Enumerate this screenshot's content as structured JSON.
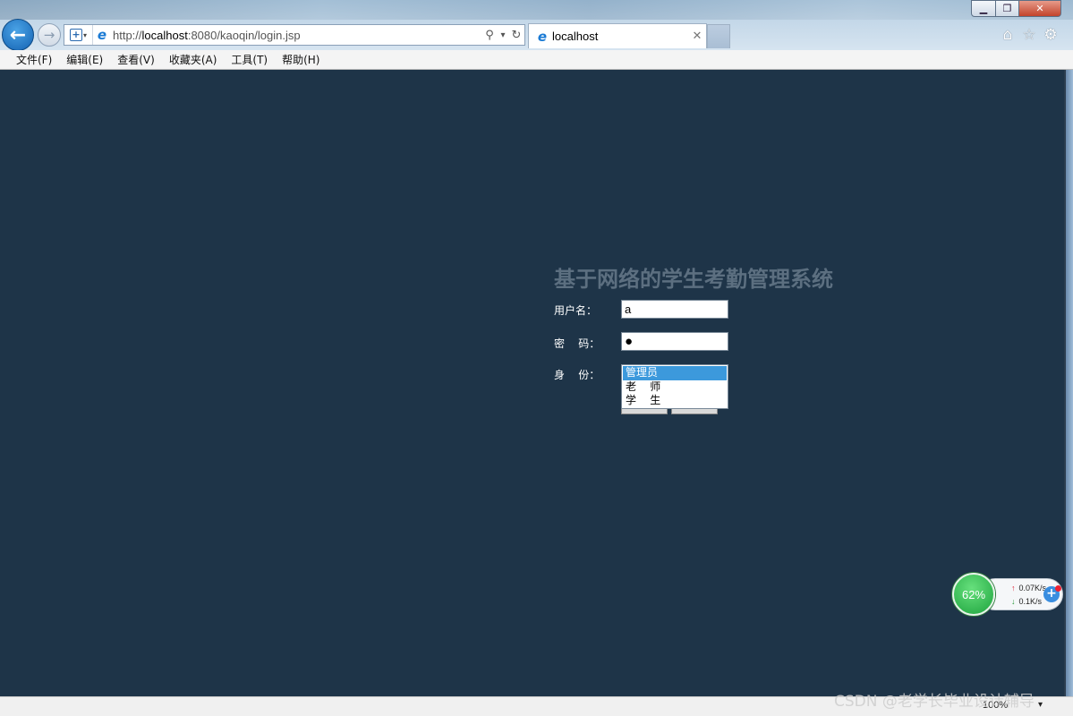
{
  "window": {
    "minimize_label": "▁",
    "maximize_label": "❐",
    "close_label": "✕"
  },
  "navigation": {
    "back_glyph": "←",
    "forward_glyph": "→"
  },
  "address_bar": {
    "url_prefix": "http://",
    "url_host": "localhost",
    "url_rest": ":8080/kaoqin/login.jsp",
    "search_glyph": "⚲",
    "dropdown_glyph": "▾",
    "refresh_glyph": "↻"
  },
  "tab": {
    "title": "localhost",
    "close_glyph": "✕"
  },
  "toolbar_icons": [
    "home-icon",
    "favorites-star-icon",
    "settings-gear-icon"
  ],
  "menu": {
    "items": [
      "文件(F)",
      "编辑(E)",
      "查看(V)",
      "收藏夹(A)",
      "工具(T)",
      "帮助(H)"
    ]
  },
  "login": {
    "title": "基于网络的学生考勤管理系统",
    "username_label": "用户名：",
    "password_label": "密    码：",
    "role_label": "身    份：",
    "username_value": "a",
    "password_mask": "●",
    "role_options": [
      "管理员",
      "老    师",
      "学    生"
    ],
    "role_selected": "管理员"
  },
  "network_widget": {
    "usage": "62%",
    "upload_speed": "0.07K/s",
    "download_speed": "0.1K/s",
    "up_arrow": "↑",
    "down_arrow": "↓",
    "plus_glyph": "+"
  },
  "status_bar": {
    "zoom": "100%",
    "zoom_caret": "▾"
  },
  "watermark": "CSDN @老学长毕业设计辅导",
  "colors": {
    "page_background": "#1e3448",
    "title_text": "#5c6f80",
    "selected_option": "#3c99dc",
    "widget_green": "#1da33d"
  }
}
